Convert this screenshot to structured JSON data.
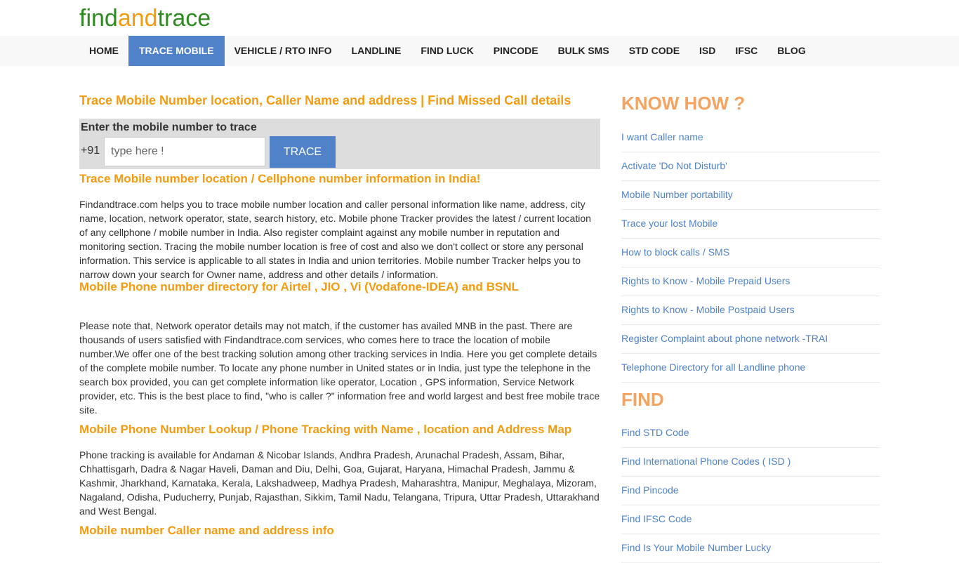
{
  "logo": {
    "part1": "find",
    "part2": "and",
    "part3": "trace"
  },
  "nav": [
    {
      "label": "HOME",
      "active": false
    },
    {
      "label": "TRACE MOBILE",
      "active": true
    },
    {
      "label": "VEHICLE / RTO INFO",
      "active": false
    },
    {
      "label": "LANDLINE",
      "active": false
    },
    {
      "label": "FIND LUCK",
      "active": false
    },
    {
      "label": "PINCODE",
      "active": false
    },
    {
      "label": "BULK SMS",
      "active": false
    },
    {
      "label": "STD CODE",
      "active": false
    },
    {
      "label": "ISD",
      "active": false
    },
    {
      "label": "IFSC",
      "active": false
    },
    {
      "label": "BLOG",
      "active": false
    }
  ],
  "main": {
    "title": "Trace Mobile Number location, Caller Name and address | Find Missed Call details",
    "trace": {
      "label": "Enter the mobile number to trace",
      "prefix": "+91",
      "placeholder": "type here !",
      "button": "TRACE"
    },
    "sections": [
      {
        "heading": "Trace Mobile number location / Cellphone number information in India!",
        "text": "Findandtrace.com helps you to trace mobile number location and caller personal information like name, address, city name, location, network operator, state, search history, etc. Mobile phone Tracker provides the latest / current location of any cellphone / mobile number in India. Also register complaint against any mobile number in reputation and monitoring section. Tracing the mobile number location is free of cost and also we don't collect or store any personal information. This service is applicable to all states in India and union territories. Mobile number Tracker helps you to narrow down your search for Owner name, address and other details / information."
      },
      {
        "heading": "Mobile Phone number directory for Airtel , JIO , Vi (Vodafone-IDEA) and BSNL",
        "text": "Please note that, Network operator details may not match, if the customer has availed MNB in the past. There are thousands of users satisfied with Findandtrace.com services, who comes here to trace the location of mobile number.We offer one of the best tracking solution among other tracking services in India. Here you get complete details of the complete mobile number. To locate any phone number in United states or in India, just type the telephone in the search box provided, you can get complete information like operator, Location , GPS information, Service Network provider, etc. This is the best place to find, \"who is caller ?\" information free and world largest and best free mobile trace site."
      },
      {
        "heading": "Mobile Phone Number Lookup / Phone Tracking with Name , location and Address Map",
        "text": "Phone tracking is available for Andaman & Nicobar Islands, Andhra Pradesh, Arunachal Pradesh, Assam, Bihar, Chhattisgarh, Dadra & Nagar Haveli, Daman and Diu, Delhi, Goa, Gujarat, Haryana, Himachal Pradesh, Jammu & Kashmir, Jharkhand, Karnataka, Kerala, Lakshadweep, Madhya Pradesh, Maharashtra, Manipur, Meghalaya, Mizoram, Nagaland, Odisha, Puducherry, Punjab, Rajasthan, Sikkim, Tamil Nadu, Telangana, Tripura, Uttar Pradesh, Uttarakhand and West Bengal."
      },
      {
        "heading": "Mobile number Caller name and address info",
        "text": ""
      }
    ]
  },
  "sidebar": {
    "know_how": {
      "heading": "KNOW HOW ?",
      "items": [
        "I want Caller name",
        "Activate 'Do Not Disturb'",
        "Mobile Number portability",
        "Trace your lost Mobile",
        "How to block calls / SMS",
        "Rights to Know - Mobile Prepaid Users",
        "Rights to Know - Mobile Postpaid Users",
        "Register Complaint about phone network -TRAI",
        "Telephone Directory for all Landline phone"
      ]
    },
    "find": {
      "heading": "FIND",
      "items": [
        "Find STD Code",
        "Find International Phone Codes ( ISD )",
        "Find Pincode",
        "Find IFSC Code",
        "Find Is Your Mobile Number Lucky"
      ]
    }
  }
}
